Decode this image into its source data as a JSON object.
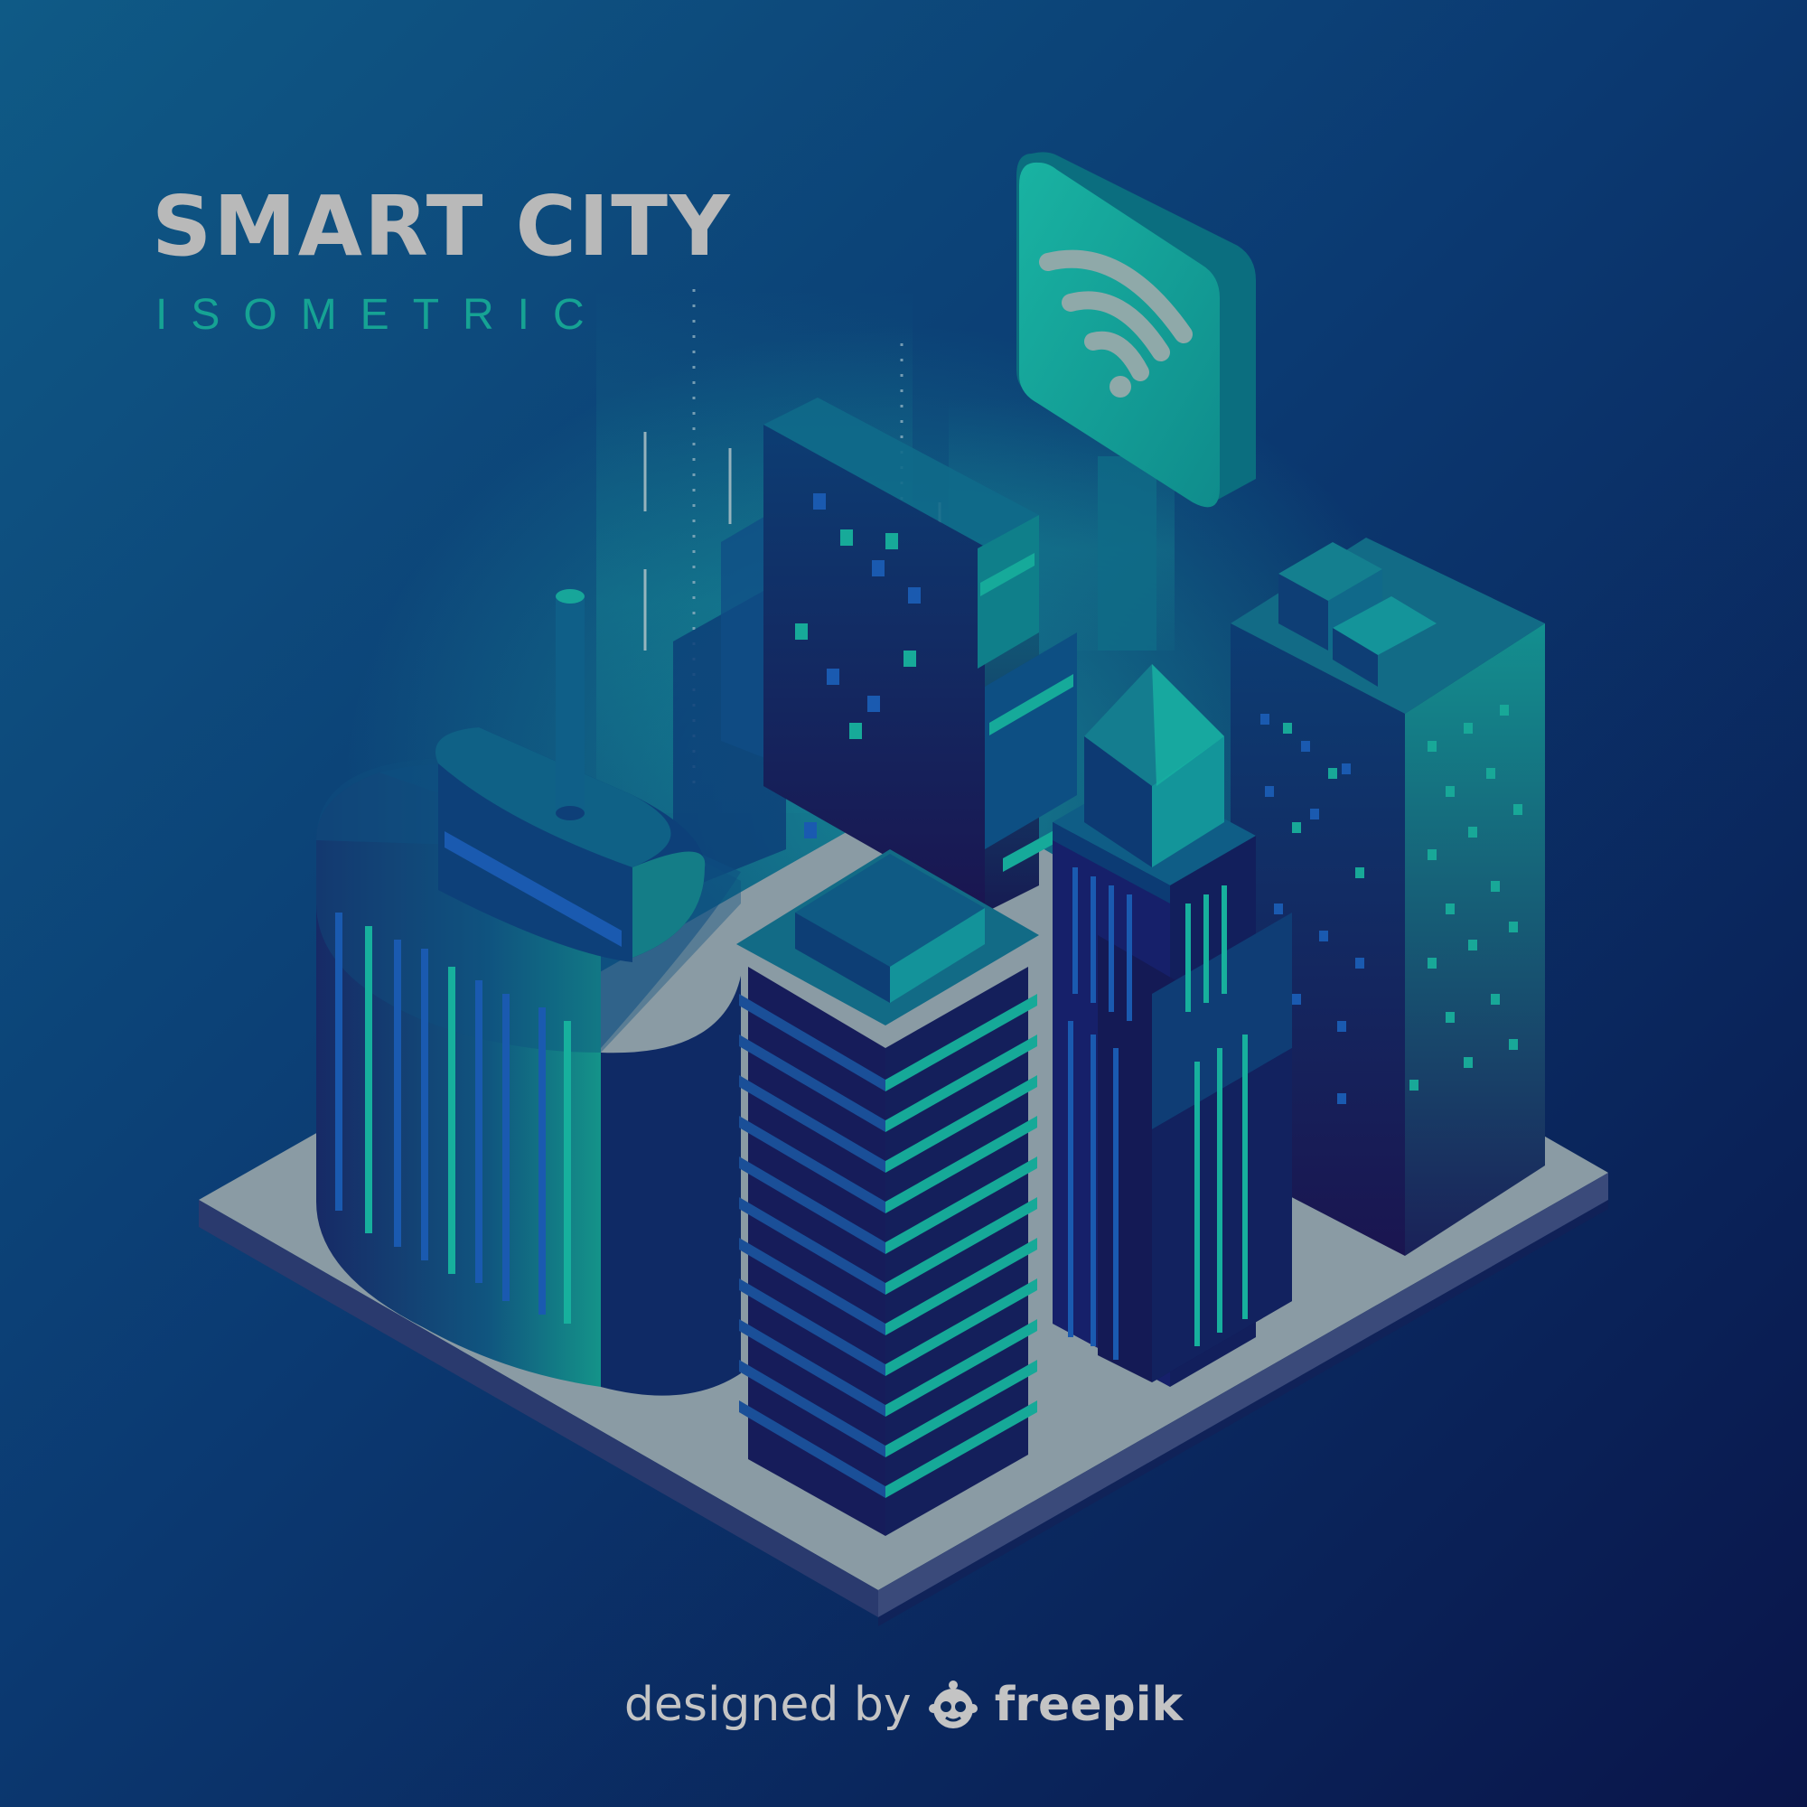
{
  "heading": {
    "title": "SMART CITY",
    "subtitle": "ISOMETRIC"
  },
  "credit": {
    "prefix": "designed by",
    "brand": "freepik",
    "logo_icon": "freepik-logo-icon"
  },
  "colors": {
    "background_top": "#0f4f80",
    "background_bottom": "#0a1a4a",
    "title": "#b9b9b9",
    "subtitle": "#16a394",
    "teal": "#13a596",
    "platform_top": "#8a9ba4",
    "credit_text": "#c4c4c4"
  }
}
